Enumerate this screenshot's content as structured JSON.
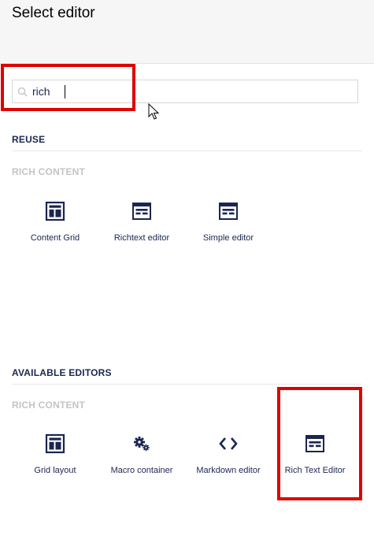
{
  "dialog": {
    "title": "Select editor"
  },
  "search": {
    "value": "rich",
    "placeholder": ""
  },
  "reuse": {
    "heading": "REUSE",
    "group": "RICH CONTENT",
    "items": [
      {
        "label": "Content Grid",
        "icon": "grid-layout-icon"
      },
      {
        "label": "Richtext editor",
        "icon": "rich-text-icon"
      },
      {
        "label": "Simple editor",
        "icon": "rich-text-icon"
      }
    ]
  },
  "available": {
    "heading": "AVAILABLE EDITORS",
    "group": "RICH CONTENT",
    "items": [
      {
        "label": "Grid layout",
        "icon": "grid-layout-icon"
      },
      {
        "label": "Macro container",
        "icon": "gears-icon"
      },
      {
        "label": "Markdown editor",
        "icon": "code-icon"
      },
      {
        "label": "Rich Text Editor",
        "icon": "rich-text-icon"
      }
    ]
  },
  "colors": {
    "highlight": "#e00000",
    "text": "#1b264f",
    "muted": "#c4c4c4"
  }
}
